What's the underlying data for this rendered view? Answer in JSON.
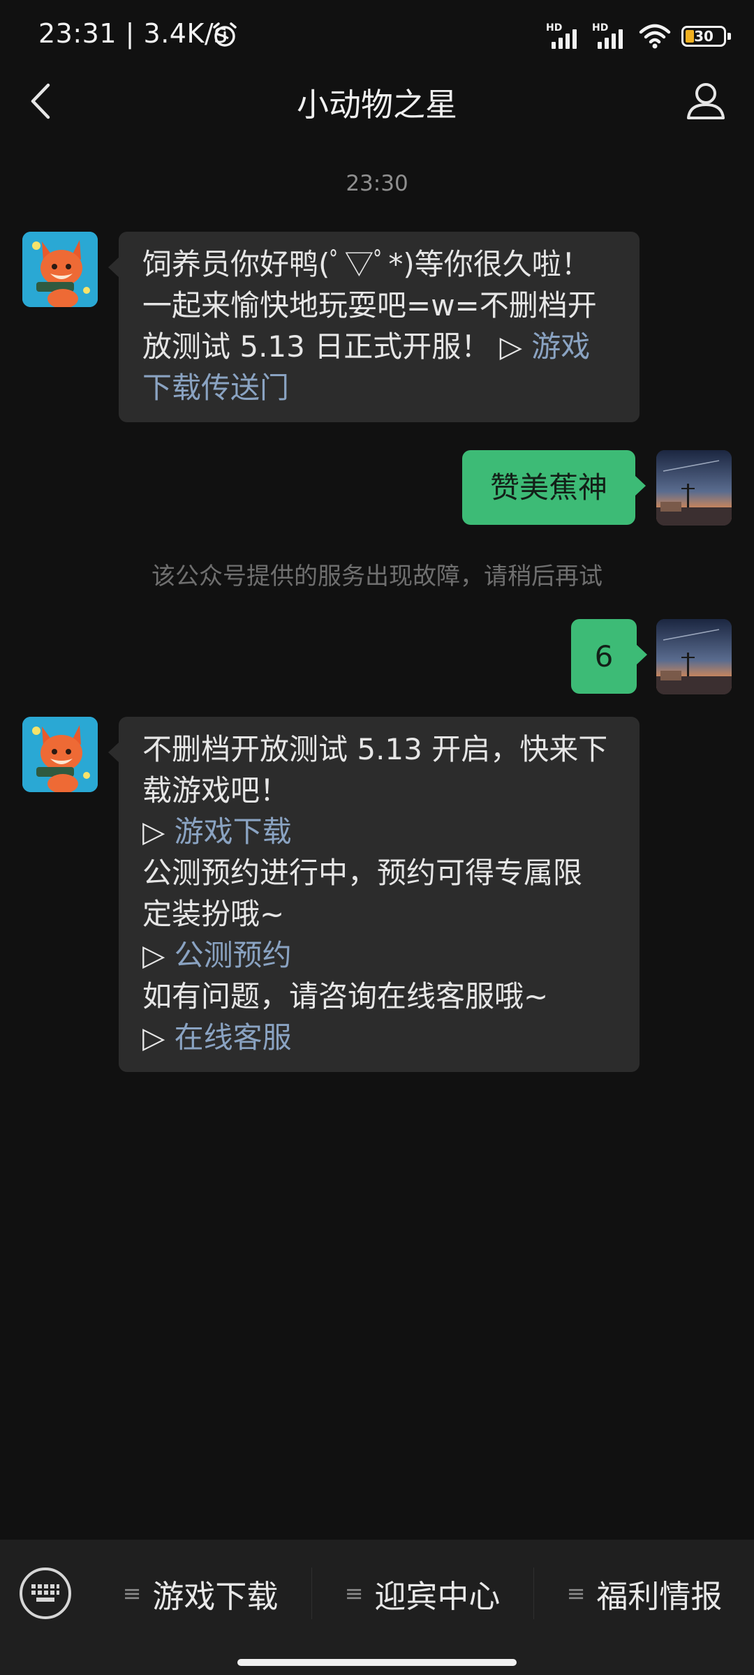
{
  "status_bar": {
    "time": "23:31",
    "separator": "|",
    "net_speed": "3.4K/s",
    "signal1_label": "HD",
    "signal2_label": "HD",
    "battery": "30"
  },
  "header": {
    "title": "小动物之星"
  },
  "chat": {
    "timestamp": "23:30",
    "msg1": {
      "line1": "饲养员你好鸭(ﾟ▽ﾟ*)等你很久啦！",
      "line2": "一起来愉快地玩耍吧=w=不删档开",
      "line3_text": "放测试 5.13 日正式开服！",
      "line3_arrow": " ▷ ",
      "line3_link": "游戏",
      "line4_link": "下载传送门"
    },
    "msg2": {
      "text": "赞美蕉神"
    },
    "system_notice": "该公众号提供的服务出现故障，请稍后再试",
    "msg3": {
      "text": "6"
    },
    "msg4": {
      "line1": "不删档开放测试 5.13 开启，快来下",
      "line2": "载游戏吧！",
      "link1_arrow": "▷ ",
      "link1": "游戏下载",
      "line4": "公测预约进行中，预约可得专属限",
      "line5": "定装扮哦~",
      "link2_arrow": "▷ ",
      "link2": "公测预约",
      "line7": "如有问题，请咨询在线客服哦~",
      "link3_arrow": "▷ ",
      "link3": "在线客服"
    }
  },
  "bottom_menu": {
    "items": [
      {
        "icon": "≡",
        "label": "游戏下载"
      },
      {
        "icon": "≡",
        "label": "迎宾中心"
      },
      {
        "icon": "≡",
        "label": "福利情报"
      }
    ]
  },
  "colors": {
    "background": "#111111",
    "incoming_bubble": "#2c2c2c",
    "outgoing_bubble": "#3dbb76",
    "link": "#8aa3c2",
    "menu_bar": "#1f1f1f"
  },
  "icons": {
    "back": "chevron-left-icon",
    "profile": "person-icon",
    "keyboard": "keyboard-icon",
    "alarm": "alarm-clock-icon",
    "wifi": "wifi-icon"
  }
}
